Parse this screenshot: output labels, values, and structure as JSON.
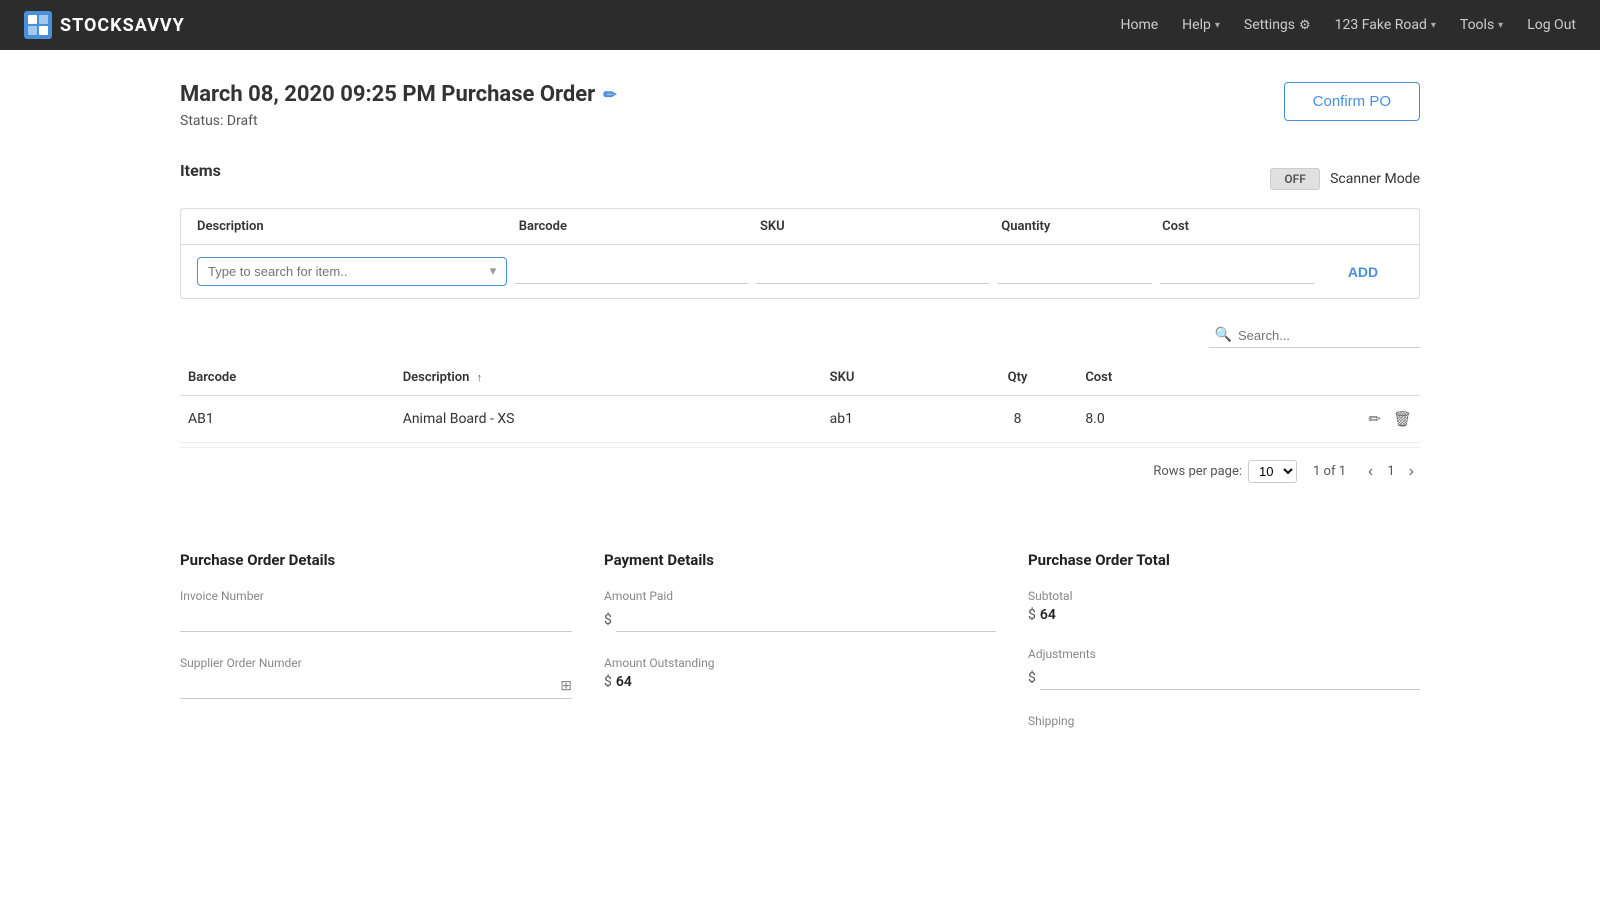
{
  "brand": {
    "name": "STOCKSAVVY"
  },
  "navbar": {
    "home": "Home",
    "help": "Help",
    "settings": "Settings",
    "location": "123 Fake Road",
    "tools": "Tools",
    "logout": "Log Out"
  },
  "page": {
    "title": "March 08, 2020 09:25 PM Purchase Order",
    "status": "Status: Draft",
    "confirm_btn": "Confirm PO"
  },
  "items_section": {
    "label": "Items",
    "scanner_off": "OFF",
    "scanner_mode": "Scanner Mode",
    "search_placeholder": "Type to search for item.."
  },
  "add_table": {
    "headers": {
      "description": "Description",
      "barcode": "Barcode",
      "sku": "SKU",
      "quantity": "Quantity",
      "cost": "Cost"
    },
    "add_btn": "ADD"
  },
  "items_list": {
    "search_placeholder": "Search...",
    "headers": {
      "barcode": "Barcode",
      "description": "Description",
      "sku": "SKU",
      "qty": "Qty",
      "cost": "Cost"
    },
    "rows": [
      {
        "barcode": "AB1",
        "description": "Animal Board - XS",
        "sku": "ab1",
        "qty": "8",
        "cost": "8.0"
      }
    ]
  },
  "pagination": {
    "rows_per_page_label": "Rows per page:",
    "rows_per_page_value": "10",
    "page_info": "1 of 1",
    "current_page": "1"
  },
  "purchase_order_details": {
    "title": "Purchase Order Details",
    "invoice_number_label": "Invoice Number",
    "invoice_number_value": "",
    "supplier_order_label": "Supplier Order Numder",
    "supplier_order_value": ""
  },
  "payment_details": {
    "title": "Payment Details",
    "amount_paid_label": "Amount Paid",
    "amount_paid_symbol": "$",
    "amount_paid_value": "",
    "amount_outstanding_label": "Amount Outstanding",
    "amount_outstanding_symbol": "$",
    "amount_outstanding_value": "64"
  },
  "po_total": {
    "title": "Purchase Order Total",
    "subtotal_label": "Subtotal",
    "subtotal_symbol": "$",
    "subtotal_value": "64",
    "adjustments_label": "Adjustments",
    "adjustments_symbol": "$",
    "adjustments_value": "",
    "shipping_label": "Shipping"
  }
}
